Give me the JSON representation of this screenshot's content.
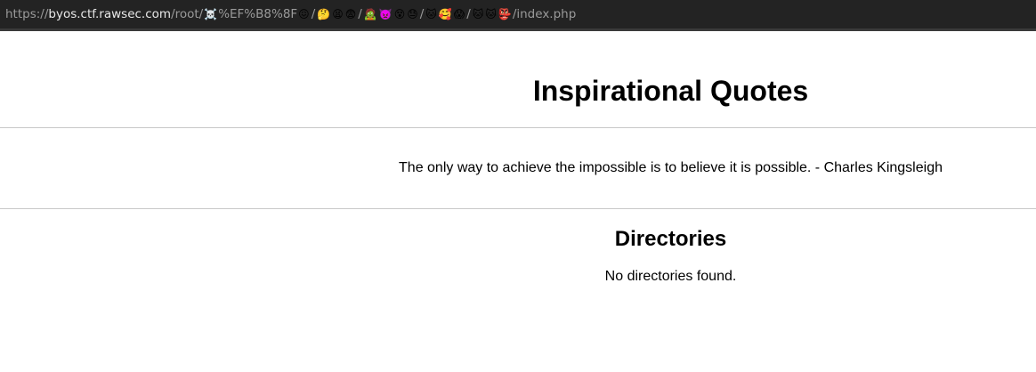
{
  "address_bar": {
    "scheme": "https://",
    "host": "byos.ctf.rawsec.com",
    "path_prefix": "/root/",
    "segment1": [
      "☠️",
      "%EF%B8%8F",
      "😖"
    ],
    "segment2": [
      "🤔",
      "😫",
      "😨"
    ],
    "segment3": [
      "🧟",
      "👿",
      "😵",
      "😓"
    ],
    "segment4": [
      "🐱",
      "🥰",
      "😱"
    ],
    "segment5": [
      "🐱",
      "🐱",
      "👺"
    ],
    "file": "/index.php",
    "sep": "/"
  },
  "page": {
    "title": "Inspirational Quotes",
    "quote": "The only way to achieve the impossible is to believe it is possible. - Charles Kingsleigh",
    "directories_heading": "Directories",
    "directories_empty": "No directories found."
  }
}
